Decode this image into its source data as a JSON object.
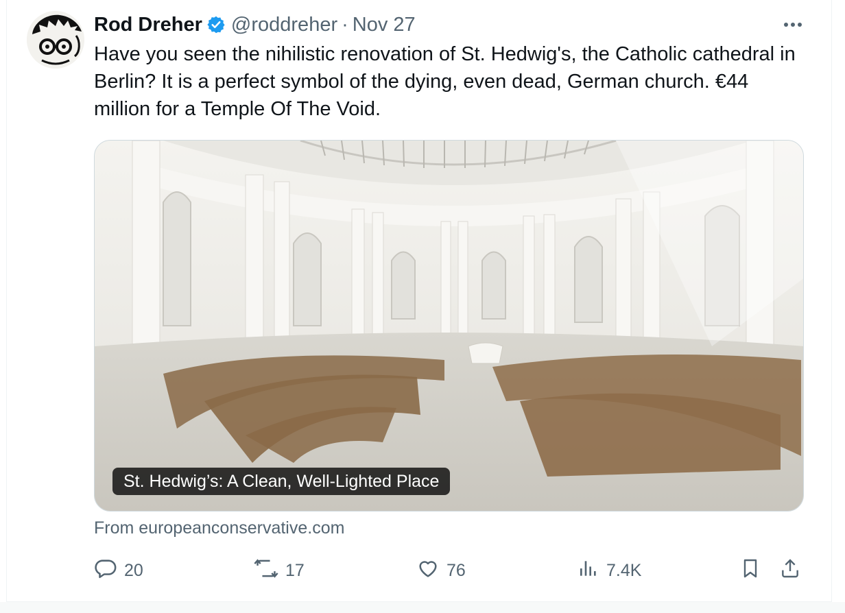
{
  "tweet": {
    "author": {
      "name": "Rod Dreher",
      "handle": "@roddreher",
      "verified": true
    },
    "separator": "·",
    "date": "Nov 27",
    "text": "Have you seen the nihilistic renovation of St. Hedwig's, the Catholic cathedral in Berlin? It is a perfect symbol of the dying, even dead, German church. €44 million for a Temple Of The Void.",
    "card": {
      "caption": "St. Hedwig’s: A Clean, Well-Lighted Place",
      "source": "From europeanconservative.com"
    },
    "actions": {
      "replies": "20",
      "reposts": "17",
      "likes": "76",
      "views": "7.4K"
    }
  },
  "icons": {
    "verified": "verified-badge-icon",
    "more": "more-dots-icon",
    "reply": "reply-bubble-icon",
    "repost": "repost-arrows-icon",
    "like": "heart-icon",
    "views": "bar-chart-icon",
    "bookmark": "bookmark-icon",
    "share": "share-upload-icon"
  },
  "colors": {
    "text_primary": "#0f1419",
    "text_secondary": "#536471",
    "verified_blue": "#1d9bf0",
    "border": "#cfd9de"
  }
}
